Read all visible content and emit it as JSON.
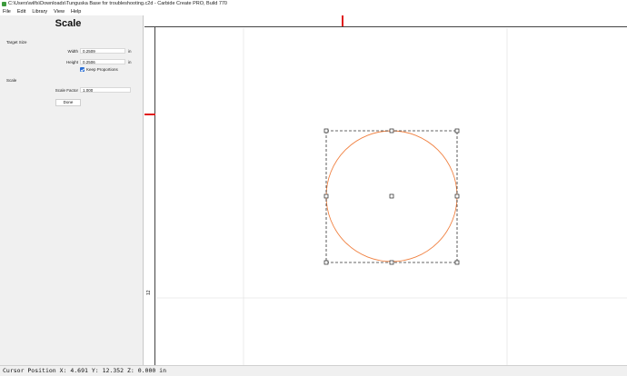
{
  "window": {
    "title": "C:\\Users\\wilfs\\Downloads\\Tunguska Base for troubleshooting.c2d - Carbide Create PRO, Build 770"
  },
  "menu": {
    "items": [
      "File",
      "Edit",
      "Library",
      "View",
      "Help"
    ]
  },
  "panel": {
    "title": "Scale",
    "target_size_label": "Target Size",
    "width_label": "Width",
    "width_value": "0.2509",
    "width_unit": "in",
    "height_label": "Height",
    "height_value": "0.2506",
    "height_unit": "in",
    "keep_proportions_label": "Keep Proportions",
    "keep_proportions_checked": true,
    "scale_section_label": "Scale",
    "scale_factor_label": "Scale Factor",
    "scale_factor_value": "1.000",
    "done_label": "Done"
  },
  "ruler": {
    "left_tick_label": "12"
  },
  "colors": {
    "accent": "#e01b1b",
    "shape_stroke": "#f08040",
    "checkbox": "#2a6fd6"
  },
  "status": {
    "cursor_text": "Cursor Position X: 4.691 Y: 12.352 Z: 0.000 in"
  }
}
